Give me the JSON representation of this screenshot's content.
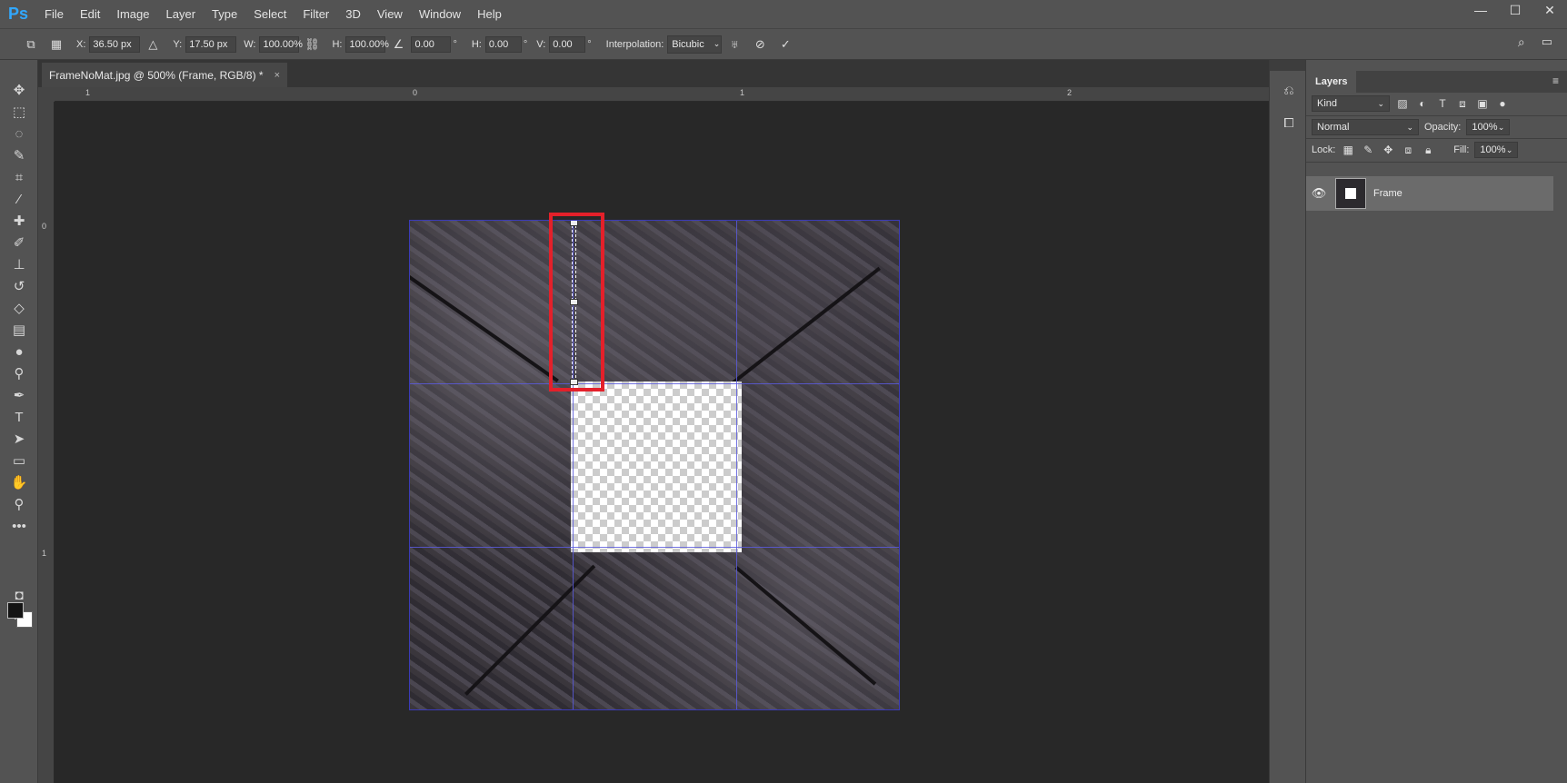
{
  "app": {
    "logo": "Ps"
  },
  "menu": [
    "File",
    "Edit",
    "Image",
    "Layer",
    "Type",
    "Select",
    "Filter",
    "3D",
    "View",
    "Window",
    "Help"
  ],
  "window_controls": {
    "minimize": "—",
    "maximize": "☐",
    "close": "✕"
  },
  "options": {
    "x_label": "X:",
    "x_value": "36.50 px",
    "y_label": "Y:",
    "y_value": "17.50 px",
    "w_label": "W:",
    "w_value": "100.00%",
    "h_label": "H:",
    "h_value": "100.00%",
    "angle_value": "0.00",
    "angle_unit": "°",
    "hskew_label": "H:",
    "hskew_value": "0.00",
    "hskew_unit": "°",
    "vskew_label": "V:",
    "vskew_value": "0.00",
    "vskew_unit": "°",
    "interpolation_label": "Interpolation:",
    "interpolation_value": "Bicubic",
    "cancel_icon": "⃠",
    "commit_icon": "✓"
  },
  "document": {
    "tab_title": "FrameNoMat.jpg @ 500% (Frame, RGB/8) *",
    "tab_close": "×"
  },
  "rulers": {
    "top": [
      "1",
      "0",
      "1",
      "2"
    ],
    "left": [
      "0",
      "1"
    ]
  },
  "layers_panel": {
    "title": "Layers",
    "filter_kind": "Kind",
    "blend_mode": "Normal",
    "opacity_label": "Opacity:",
    "opacity_value": "100%",
    "lock_label": "Lock:",
    "fill_label": "Fill:",
    "fill_value": "100%",
    "layers": [
      {
        "name": "Frame"
      }
    ]
  },
  "colors": {
    "accent_blue": "#31a8ff",
    "highlight_red": "#e4202a",
    "slice_blue": "#5a5adc"
  }
}
